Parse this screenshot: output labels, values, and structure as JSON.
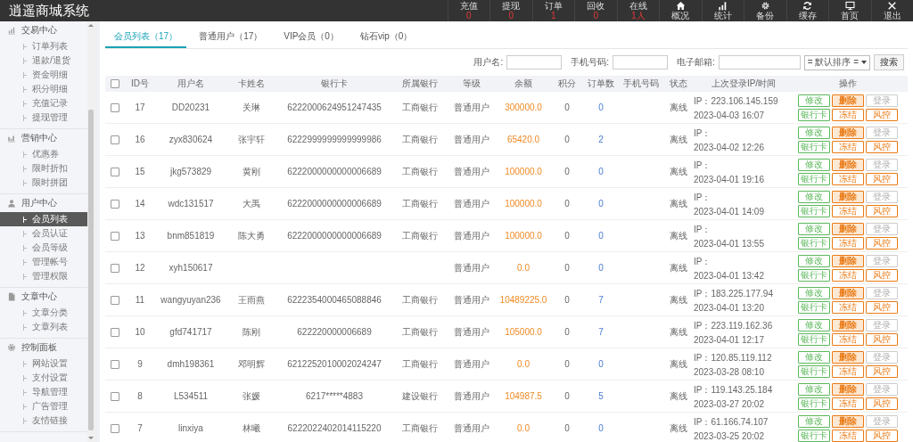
{
  "app": {
    "title": "逍遥商城系统"
  },
  "topbar": {
    "stats": [
      {
        "label": "充值",
        "value": "0"
      },
      {
        "label": "提现",
        "value": "0"
      },
      {
        "label": "订单",
        "value": "1"
      },
      {
        "label": "回收",
        "value": "0"
      },
      {
        "label": "在线",
        "value": "1人"
      }
    ],
    "shortcuts": [
      {
        "label": "概况"
      },
      {
        "label": "统计"
      },
      {
        "label": "备份"
      },
      {
        "label": "缓存"
      },
      {
        "label": "首页"
      },
      {
        "label": "退出"
      }
    ]
  },
  "sidebar": {
    "groups": [
      {
        "title": "交易中心",
        "items": [
          {
            "label": "订单列表",
            "selected": false
          },
          {
            "label": "退款/退货",
            "selected": false
          },
          {
            "label": "资金明细",
            "selected": false
          },
          {
            "label": "积分明细",
            "selected": false
          },
          {
            "label": "充值记录",
            "selected": false
          },
          {
            "label": "提现管理",
            "selected": false
          }
        ]
      },
      {
        "title": "营销中心",
        "items": [
          {
            "label": "优惠券",
            "selected": false
          },
          {
            "label": "限时折扣",
            "selected": false
          },
          {
            "label": "限时拼团",
            "selected": false
          }
        ]
      },
      {
        "title": "用户中心",
        "items": [
          {
            "label": "会员列表",
            "selected": true
          },
          {
            "label": "会员认证",
            "selected": false
          },
          {
            "label": "会员等级",
            "selected": false
          },
          {
            "label": "管理帐号",
            "selected": false
          },
          {
            "label": "管理权限",
            "selected": false
          }
        ]
      },
      {
        "title": "文章中心",
        "items": [
          {
            "label": "文章分类",
            "selected": false
          },
          {
            "label": "文章列表",
            "selected": false
          }
        ]
      },
      {
        "title": "控制面板",
        "items": [
          {
            "label": "网站设置",
            "selected": false
          },
          {
            "label": "支付设置",
            "selected": false
          },
          {
            "label": "导航管理",
            "selected": false
          },
          {
            "label": "广告管理",
            "selected": false
          },
          {
            "label": "友情链接",
            "selected": false
          }
        ]
      }
    ]
  },
  "tabs": [
    {
      "label": "会员列表（17）",
      "selected": true
    },
    {
      "label": "普通用户（17）",
      "selected": false
    },
    {
      "label": "VIP会员（0）",
      "selected": false
    },
    {
      "label": "钻石vip（0）",
      "selected": false
    }
  ],
  "filters": {
    "fields": [
      {
        "label": "用户名:"
      },
      {
        "label": "手机号码:"
      },
      {
        "label": "电子邮箱:"
      }
    ],
    "sort": {
      "value": "= 默认排序 ="
    },
    "search_button": "搜索"
  },
  "table": {
    "header_checkbox": {
      "checked": false
    },
    "columns": [
      "ID号",
      "用户名",
      "卡姓名",
      "银行卡",
      "所属银行",
      "等级",
      "余额",
      "积分",
      "订单数",
      "手机号码",
      "状态",
      "上次登录IP/时间",
      "操作"
    ],
    "rows": [
      {
        "checked": false,
        "id": "17",
        "username": "DD20231",
        "card_name": "关琳",
        "bank_card": "6222000624951247435",
        "bank": "工商银行",
        "level": "普通用户",
        "balance": "300000.0",
        "points": "0",
        "orders": "0",
        "status": "离线",
        "ip": "IP：223.106.145.159",
        "time": "2023-04-03 16:07",
        "actions": [
          "修改",
          "删除",
          "登录",
          "银行卡",
          "冻结",
          "风控"
        ]
      },
      {
        "checked": false,
        "id": "16",
        "username": "zyx830624",
        "card_name": "张宇轩",
        "bank_card": "6222999999999999986",
        "bank": "工商银行",
        "level": "普通用户",
        "balance": "65420.0",
        "points": "0",
        "orders": "2",
        "status": "离线",
        "ip": "IP：",
        "time": "2023-04-02 12:26",
        "actions": [
          "修改",
          "删除",
          "登录",
          "银行卡",
          "冻结",
          "风控"
        ]
      },
      {
        "checked": false,
        "id": "15",
        "username": "jkg573829",
        "card_name": "黄刚",
        "bank_card": "6222000000000006689",
        "bank": "工商银行",
        "level": "普通用户",
        "balance": "100000.0",
        "points": "0",
        "orders": "0",
        "status": "离线",
        "ip": "IP：",
        "time": "2023-04-01 19:16",
        "actions": [
          "修改",
          "删除",
          "登录",
          "银行卡",
          "冻结",
          "风控"
        ]
      },
      {
        "checked": false,
        "id": "14",
        "username": "wdc131517",
        "card_name": "大禹",
        "bank_card": "6222000000000006689",
        "bank": "工商银行",
        "level": "普通用户",
        "balance": "100000.0",
        "points": "0",
        "orders": "0",
        "status": "离线",
        "ip": "IP：",
        "time": "2023-04-01 14:09",
        "actions": [
          "修改",
          "删除",
          "登录",
          "银行卡",
          "冻结",
          "风控"
        ]
      },
      {
        "checked": false,
        "id": "13",
        "username": "bnm851819",
        "card_name": "陈大勇",
        "bank_card": "6222000000000006689",
        "bank": "工商银行",
        "level": "普通用户",
        "balance": "100000.0",
        "points": "0",
        "orders": "0",
        "status": "离线",
        "ip": "IP：",
        "time": "2023-04-01 13:55",
        "actions": [
          "修改",
          "删除",
          "登录",
          "银行卡",
          "冻结",
          "风控"
        ]
      },
      {
        "checked": false,
        "id": "12",
        "username": "xyh150617",
        "level": "普通用户",
        "balance": "0.0",
        "points": "0",
        "orders": "0",
        "status": "离线",
        "ip": "IP：",
        "time": "2023-04-01 13:42",
        "actions": [
          "修改",
          "删除",
          "登录",
          "银行卡",
          "冻结",
          "风控"
        ]
      },
      {
        "checked": false,
        "id": "11",
        "username": "wangyuyan236",
        "card_name": "王雨燕",
        "bank_card": "6222354000465088846",
        "bank": "工商银行",
        "level": "普通用户",
        "balance": "10489225.0",
        "points": "0",
        "orders": "7",
        "status": "离线",
        "ip": "IP：183.225.177.94",
        "time": "2023-04-01 13:20",
        "actions": [
          "修改",
          "删除",
          "登录",
          "银行卡",
          "冻结",
          "风控"
        ]
      },
      {
        "checked": false,
        "id": "10",
        "username": "gfd741717",
        "card_name": "陈刚",
        "bank_card": "622220000006689",
        "bank": "工商银行",
        "level": "普通用户",
        "balance": "105000.0",
        "points": "0",
        "orders": "7",
        "status": "离线",
        "ip": "IP：223.119.162.36",
        "time": "2023-04-01 12:17",
        "actions": [
          "修改",
          "删除",
          "登录",
          "银行卡",
          "冻结",
          "风控"
        ]
      },
      {
        "checked": false,
        "id": "9",
        "username": "dmh198361",
        "card_name": "邓明辉",
        "bank_card": "6212252010002024247",
        "bank": "工商银行",
        "level": "普通用户",
        "balance": "0.0",
        "points": "0",
        "orders": "0",
        "status": "离线",
        "ip": "IP：120.85.119.112",
        "time": "2023-03-28 08:10",
        "actions": [
          "修改",
          "删除",
          "登录",
          "银行卡",
          "冻结",
          "风控"
        ]
      },
      {
        "checked": false,
        "id": "8",
        "username": "L534511",
        "card_name": "张媛",
        "bank_card": "6217*****4883",
        "bank": "建设银行",
        "level": "普通用户",
        "balance": "104987.5",
        "points": "0",
        "orders": "5",
        "status": "离线",
        "ip": "IP：119.143.25.184",
        "time": "2023-03-27 20:02",
        "actions": [
          "修改",
          "删除",
          "登录",
          "银行卡",
          "冻结",
          "风控"
        ]
      },
      {
        "checked": false,
        "id": "7",
        "username": "linxiya",
        "card_name": "林曦",
        "bank_card": "6222022402014115220",
        "bank": "工商银行",
        "level": "普通用户",
        "balance": "0.0",
        "points": "0",
        "orders": "0",
        "status": "离线",
        "ip": "IP：61.166.74.107",
        "time": "2023-03-25 20:02",
        "actions": [
          "修改",
          "删除",
          "登录",
          "银行卡",
          "冻结",
          "风控"
        ]
      }
    ]
  }
}
